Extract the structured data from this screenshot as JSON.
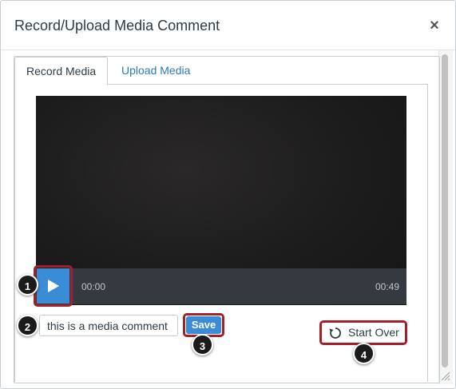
{
  "dialog": {
    "title": "Record/Upload Media Comment",
    "close_symbol": "×"
  },
  "tabs": [
    {
      "label": "Record Media",
      "active": true
    },
    {
      "label": "Upload Media",
      "active": false
    }
  ],
  "player": {
    "current_time": "00:00",
    "duration": "00:49",
    "play_icon": "play-icon"
  },
  "comment": {
    "value": "this is a media comment"
  },
  "actions": {
    "save_label": "Save",
    "start_over_label": "Start Over",
    "start_over_icon": "refresh-icon"
  },
  "callouts": [
    "1",
    "2",
    "3",
    "4"
  ],
  "colors": {
    "accent": "#3b8cd6",
    "link": "#2b7abc",
    "highlight": "#a3202b",
    "badge": "#1b1b1b"
  }
}
